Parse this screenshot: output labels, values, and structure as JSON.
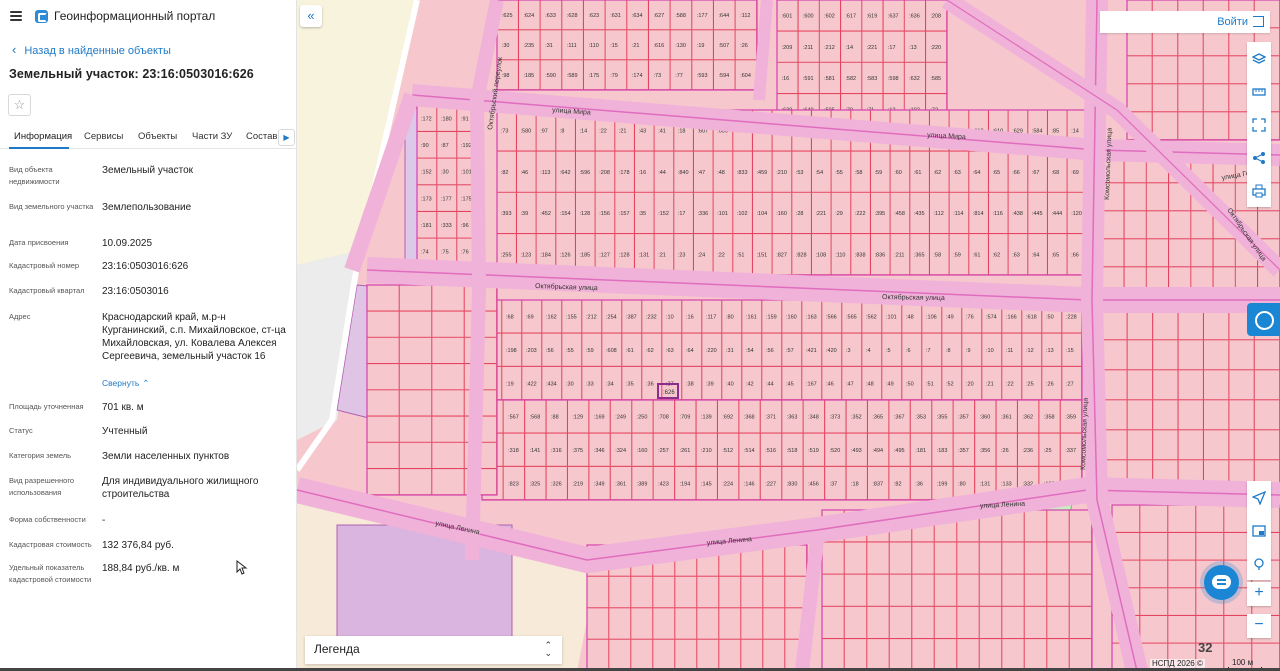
{
  "header": {
    "portal_title": "Геоинформационный портал"
  },
  "nav": {
    "back_label": "Назад в найденные объекты"
  },
  "object": {
    "title": "Земельный участок: 23:16:0503016:626"
  },
  "tabs": [
    "Информация",
    "Сервисы",
    "Объекты",
    "Части ЗУ",
    "Состав"
  ],
  "properties": [
    {
      "label": "Вид объекта недвижимости",
      "value": "Земельный участок"
    },
    {
      "label": "Вид земельного участка",
      "value": "Землепользование"
    },
    {
      "label": "Дата присвоения",
      "value": "10.09.2025"
    },
    {
      "label": "Кадастровый номер",
      "value": "23:16:0503016:626"
    },
    {
      "label": "Кадастровый квартал",
      "value": "23:16:0503016"
    },
    {
      "label": "Адрес",
      "value": "Краснодарский край, м.р-н Курганинский, с.п. Михайловское, ст-ца Михайловская, ул. Ковалева Алексея Сергеевича, земельный участок 16"
    },
    {
      "label": "Площадь уточненная",
      "value": "701 кв. м"
    },
    {
      "label": "Статус",
      "value": "Учтенный"
    },
    {
      "label": "Категория земель",
      "value": "Земли населенных пунктов"
    },
    {
      "label": "Вид разрешенного использования",
      "value": "Для индивидуального жилищного строительства"
    },
    {
      "label": "Форма собственности",
      "value": "-"
    },
    {
      "label": "Кадастровая стоимость",
      "value": "132 376,84 руб."
    },
    {
      "label": "Удельный показатель кадастровой стоимости",
      "value": "188,84 руб./кв. м"
    }
  ],
  "collapse_label": "Свернуть",
  "map": {
    "login_label": "Войти",
    "legend_label": "Легенда",
    "zoom_level": "32",
    "copyright": "НСПД 2026 ©",
    "scale_label": "100 м",
    "streets": {
      "mira1": "улица Мира",
      "mira2": "улица Мира",
      "oktyabrskaya1": "Октябрьская улица",
      "oktyabrskaya2": "Октябрьская улица",
      "lenina1": "улица Ленина",
      "lenina2": "улица Ленина",
      "lenina3": "улица Ленина",
      "oktyabrsky_per": "Октябрьский переулок",
      "komsomolskaya1": "Комсомольская улица",
      "komsomolskaya2": "Комсомольская улица",
      "gorkogo": "улица Горького",
      "oktyabrskaya_r": "Октябрьская улица"
    },
    "selected_parcel": ":626",
    "parcels": [
      ":625",
      ":624",
      ":633",
      ":628",
      ":623",
      ":631",
      ":634",
      ":627",
      ":588",
      ":177",
      ":644",
      ":112",
      ":30",
      ":235",
      ":31",
      ":111",
      ":110",
      ":15",
      ":21",
      ":616",
      ":130",
      ":19",
      ":507",
      ":26",
      ":98",
      ":185",
      ":590",
      ":589",
      ":175",
      ":79",
      ":174",
      ":73",
      ":77",
      ":593",
      ":594",
      ":604",
      ":601",
      ":600",
      ":602",
      ":617",
      ":619",
      ":637",
      ":636",
      ":208",
      ":209",
      ":211",
      ":212",
      ":14",
      ":221",
      ":17",
      ":13",
      ":220",
      ":16",
      ":591",
      ":581",
      ":582",
      ":583",
      ":598",
      ":632",
      ":585",
      ":639",
      ":640",
      ":595",
      ":70",
      ":71",
      ":12",
      ":102",
      ":72",
      ":73",
      ":580",
      ":97",
      ":8",
      ":14",
      ":22",
      ":21",
      ":43",
      ":41",
      ":18",
      ":607",
      ":606",
      ":40",
      ":39",
      ":386",
      ":387",
      ":36",
      ":35",
      ":249",
      ":23",
      ":205",
      ":550",
      ":207",
      ":612",
      ":613",
      ":610",
      ":629",
      ":584",
      ":85",
      ":14",
      ":82",
      ":46",
      ":113",
      ":642",
      ":596",
      ":208",
      ":178",
      ":16",
      ":44",
      ":840",
      ":47",
      ":48",
      ":833",
      ":459",
      ":210",
      ":53",
      ":54",
      ":55",
      ":58",
      ":59",
      ":60",
      ":61",
      ":62",
      ":63",
      ":64",
      ":65",
      ":66",
      ":67",
      ":68",
      ":69",
      ":393",
      ":39",
      ":452",
      ":154",
      ":128",
      ":156",
      ":157",
      ":35",
      ":152",
      ":17",
      ":336",
      ":101",
      ":102",
      ":104",
      ":160",
      ":28",
      ":221",
      ":29",
      ":222",
      ":395",
      ":458",
      ":435",
      ":112",
      ":114",
      ":814",
      ":116",
      ":438",
      ":445",
      ":444",
      ":120",
      ":255",
      ":123",
      ":184",
      ":126",
      ":185",
      ":127",
      ":128",
      ":131",
      ":21",
      ":23",
      ":24",
      ":22",
      ":51",
      ":151",
      ":827",
      ":828",
      ":108",
      ":110",
      ":838",
      ":836",
      ":211",
      ":365",
      ":58",
      ":59",
      ":61",
      ":62",
      ":63",
      ":64",
      ":65",
      ":66",
      ":67",
      ":68",
      ":69",
      ":162",
      ":155",
      ":212",
      ":254",
      ":387",
      ":232",
      ":10",
      ":16",
      ":117",
      ":80",
      ":161",
      ":159",
      ":160",
      ":163",
      ":566",
      ":565",
      ":562",
      ":101",
      ":48",
      ":106",
      ":49",
      ":76",
      ":574",
      ":166",
      ":618",
      ":50",
      ":228",
      ":164",
      ":198",
      ":203",
      ":56",
      ":55",
      ":59",
      ":608",
      ":61",
      ":62",
      ":63",
      ":64",
      ":220",
      ":31",
      ":54",
      ":56",
      ":57",
      ":421",
      ":420",
      ":3",
      ":4",
      ":5",
      ":6",
      ":7",
      ":8",
      ":9",
      ":10",
      ":11",
      ":12",
      ":13",
      ":15",
      ":418",
      ":19",
      ":422",
      ":434",
      ":30",
      ":33",
      ":34",
      ":35",
      ":36",
      ":37",
      ":38",
      ":39",
      ":40",
      ":42",
      ":44",
      ":45",
      ":167",
      ":46",
      ":47",
      ":48",
      ":49",
      ":50",
      ":51",
      ":52",
      ":20",
      ":21",
      ":22",
      ":25",
      ":26",
      ":27",
      ":28",
      ":567",
      ":568",
      ":88",
      ":129",
      ":169",
      ":249",
      ":250",
      ":708",
      ":709",
      ":139",
      ":692",
      ":368",
      ":371",
      ":363",
      ":348",
      ":373",
      ":352",
      ":365",
      ":367",
      ":353",
      ":355",
      ":357",
      ":360",
      ":361",
      ":362",
      ":358",
      ":359",
      ":317",
      ":318",
      ":141",
      ":316",
      ":375",
      ":346",
      ":324",
      ":160",
      ":257",
      ":261",
      ":210",
      ":512",
      ":514",
      ":516",
      ":518",
      ":519",
      ":520",
      ":493",
      ":494",
      ":495",
      ":181",
      ":183",
      ":357",
      ":356",
      ":26",
      ":236",
      ":25",
      ":337",
      ":824",
      ":823",
      ":325",
      ":326",
      ":219",
      ":349",
      ":361",
      ":389",
      ":423",
      ":194",
      ":145",
      ":224",
      ":146",
      ":227",
      ":830",
      ":456",
      ":37",
      ":18",
      ":837",
      ":82",
      ":36",
      ":199",
      ":80",
      ":131",
      ":133",
      ":332",
      ":103",
      ":121",
      ":172",
      ":180",
      ":91",
      ":90",
      ":87",
      ":192",
      ":152",
      ":30",
      ":101",
      ":173",
      ":177",
      ":175",
      ":181",
      ":333",
      ":96",
      ":74",
      ":75",
      ":76"
    ]
  },
  "colors": {
    "accent": "#1e7ac8",
    "parcel_fill": "#f6c8cd",
    "parcel_stroke": "#e54560",
    "road": "#f0b2d8",
    "road_edge": "#d63fae",
    "quarter": "#c58fc2",
    "selected": "#8b2d8c"
  },
  "icons": [
    "menu-icon",
    "logo-icon",
    "chevron-left-icon",
    "star-icon",
    "chevron-right-icon",
    "double-chevron-left-icon",
    "login-icon",
    "layers-icon",
    "ruler-icon",
    "screen-capture-icon",
    "share-icon",
    "print-icon",
    "rosreestr-icon",
    "locate-icon",
    "measure-icon",
    "pin-icon",
    "chat-icon",
    "zoom-in-icon",
    "zoom-out-icon"
  ]
}
